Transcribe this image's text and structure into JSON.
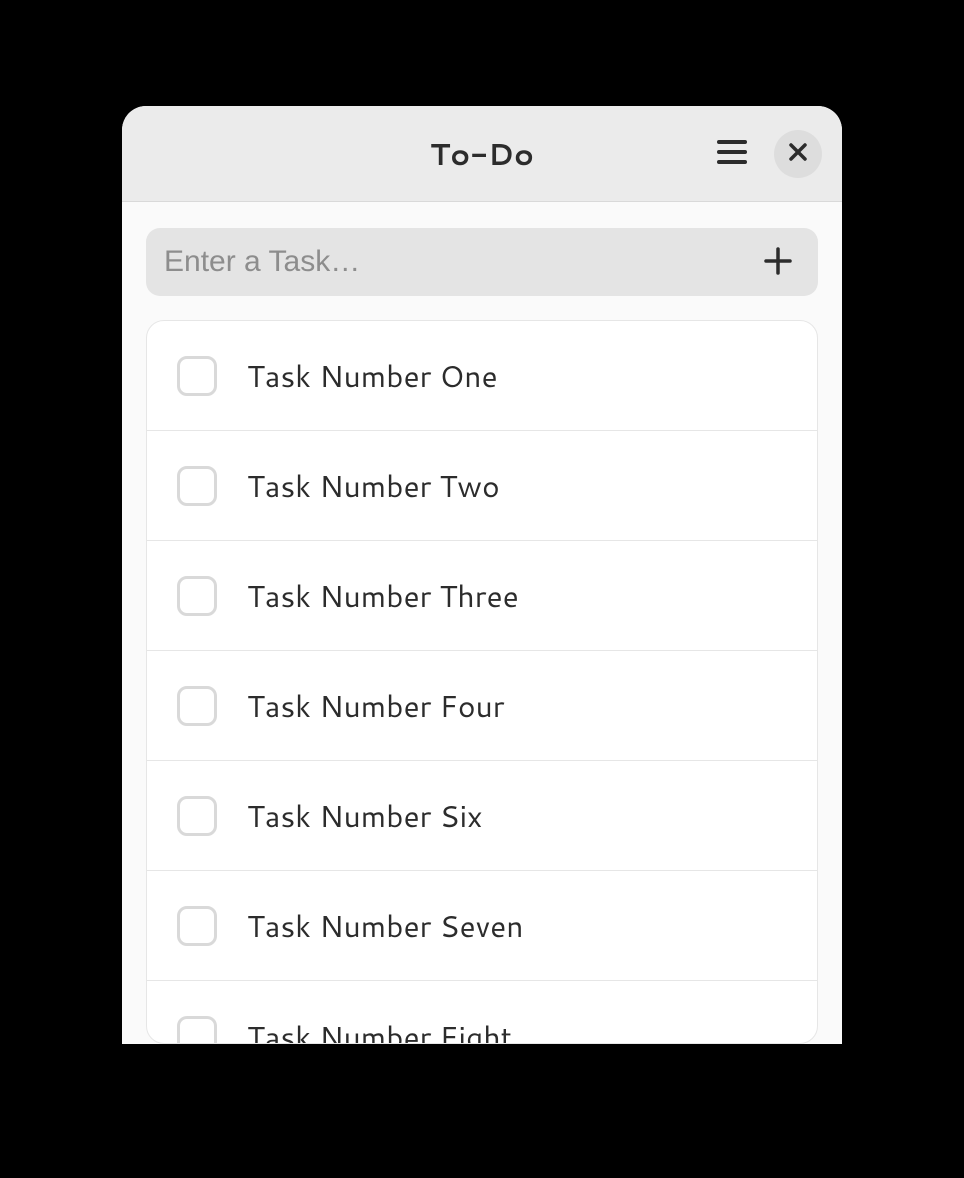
{
  "window": {
    "title": "To-Do"
  },
  "entry": {
    "placeholder": "Enter a Task…",
    "value": ""
  },
  "tasks": [
    {
      "label": "Task Number One",
      "checked": false
    },
    {
      "label": "Task Number Two",
      "checked": false
    },
    {
      "label": "Task Number Three",
      "checked": false
    },
    {
      "label": "Task Number Four",
      "checked": false
    },
    {
      "label": "Task Number Six",
      "checked": false
    },
    {
      "label": "Task Number Seven",
      "checked": false
    },
    {
      "label": "Task Number Eight",
      "checked": false
    }
  ]
}
